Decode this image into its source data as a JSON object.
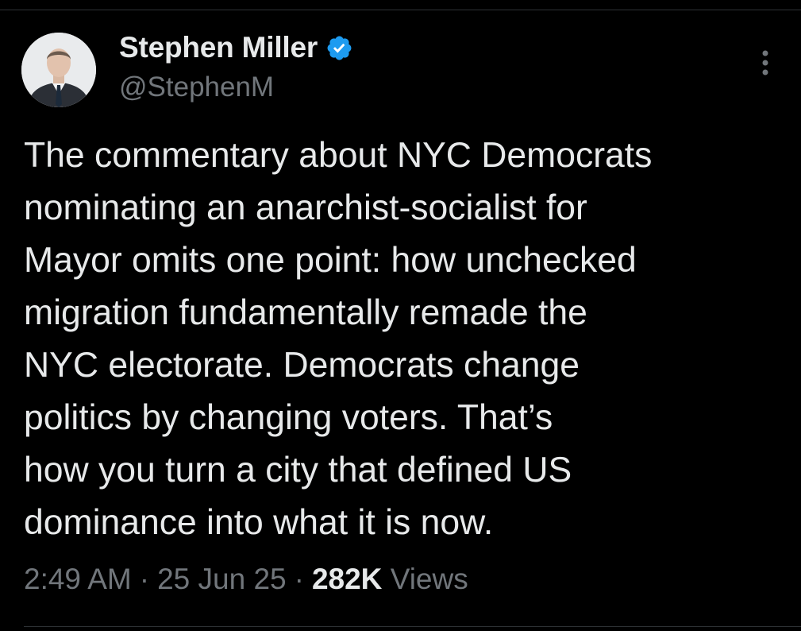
{
  "author": {
    "display_name": "Stephen Miller",
    "handle": "@StephenM",
    "verified": true,
    "avatar_icon": "profile-photo"
  },
  "tweet": {
    "text": "The commentary about NYC Democrats\nnominating an anarchist-socialist for\nMayor omits one point: how unchecked\nmigration fundamentally remade the\nNYC electorate. Democrats change\npolitics by changing voters. That’s\nhow you turn a city that defined US\ndominance into what it is now."
  },
  "meta": {
    "time": "2:49 AM",
    "separator": "·",
    "date": "25 Jun 25",
    "views_count": "282K",
    "views_label": "Views"
  },
  "colors": {
    "background": "#000000",
    "text_primary": "#e7e9ea",
    "text_secondary": "#71767b",
    "verified_blue": "#1d9bf0"
  },
  "icons": {
    "verified": "verified-badge-icon",
    "more": "more-vertical-icon"
  }
}
